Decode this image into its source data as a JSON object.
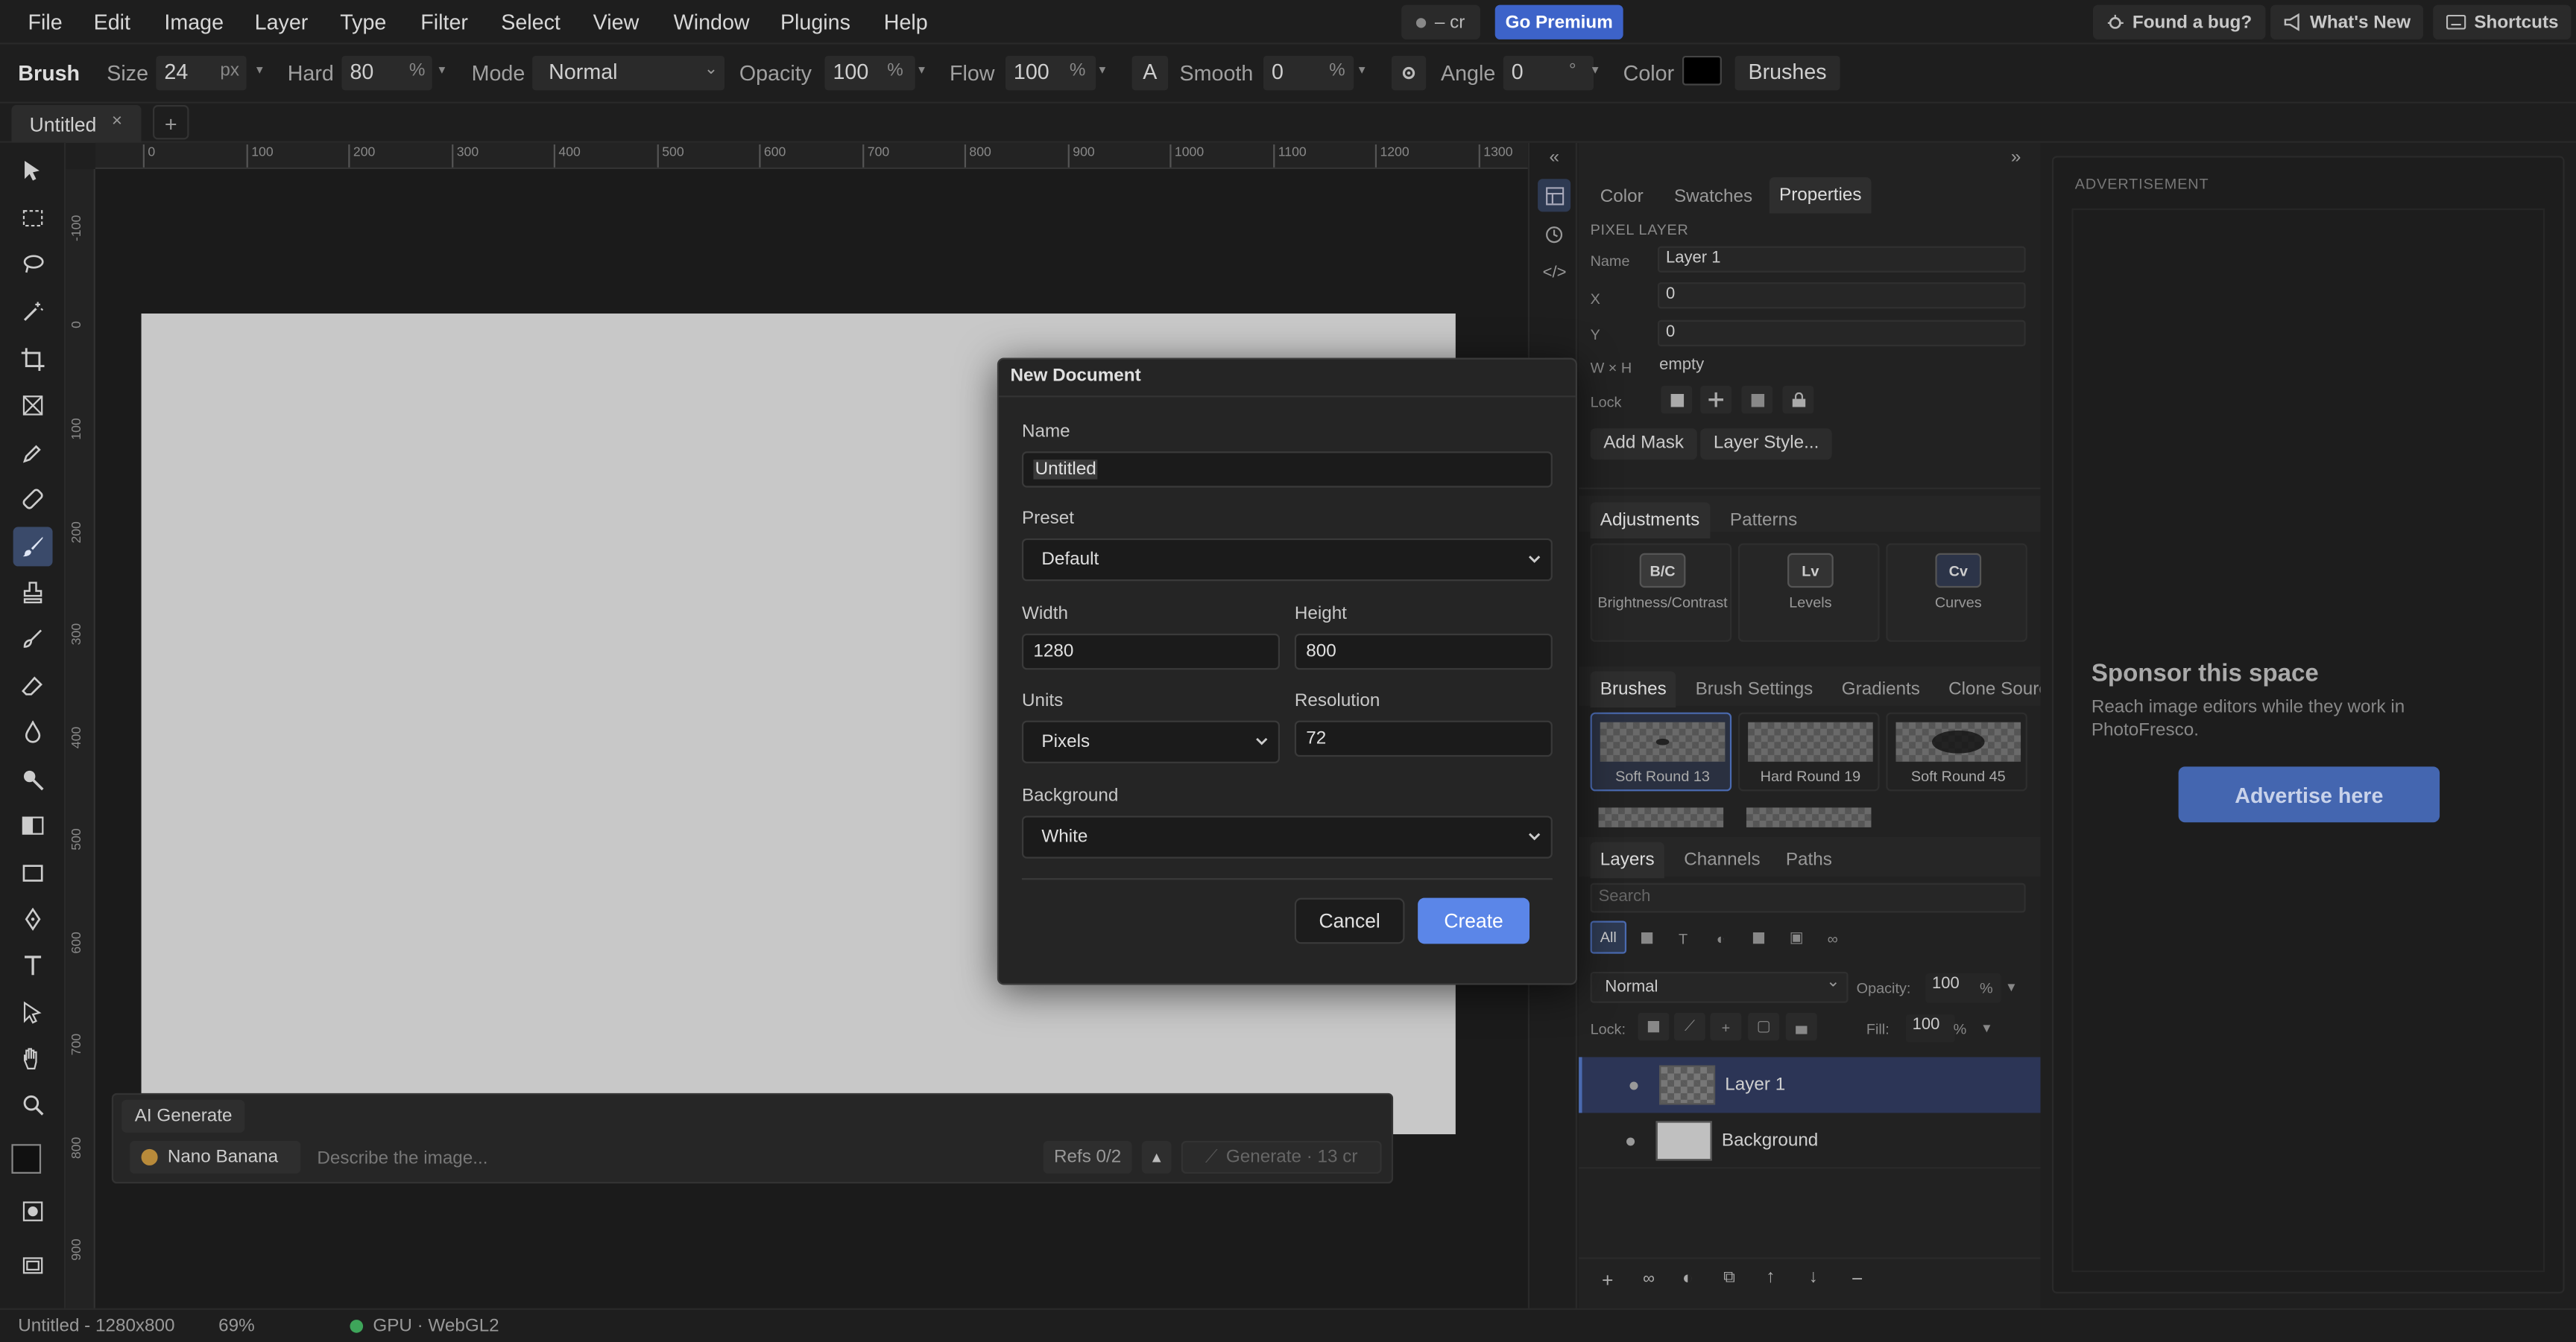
{
  "menubar": {
    "items": [
      "File",
      "Edit",
      "Image",
      "Layer",
      "Type",
      "Filter",
      "Select",
      "View",
      "Window",
      "Plugins",
      "Help"
    ],
    "credits": "– cr",
    "premium": "Go Premium",
    "bug": "Found a bug?",
    "whats_new": "What's New",
    "shortcuts": "Shortcuts"
  },
  "options": {
    "tool": "Brush",
    "size_label": "Size",
    "size": "24",
    "size_unit": "px",
    "hard_label": "Hard",
    "hard": "80",
    "hard_unit": "%",
    "mode_label": "Mode",
    "mode": "Normal",
    "opacity_label": "Opacity",
    "opacity": "100",
    "opacity_unit": "%",
    "flow_label": "Flow",
    "flow": "100",
    "flow_unit": "%",
    "a_label": "A",
    "smooth_label": "Smooth",
    "smooth": "0",
    "smooth_unit": "%",
    "angle_label": "Angle",
    "angle": "0",
    "angle_unit": "°",
    "color_label": "Color",
    "color": "#000000",
    "brushes": "Brushes"
  },
  "doc_tab": "Untitled",
  "ruler": {
    "x": [
      "0",
      "100",
      "200",
      "300",
      "400",
      "500",
      "600",
      "700",
      "800",
      "900",
      "1000",
      "1100",
      "1200",
      "1300"
    ],
    "y": [
      "-100",
      "0",
      "100",
      "200",
      "300",
      "400",
      "500",
      "600",
      "700",
      "800",
      "900"
    ]
  },
  "ai": {
    "tab": "AI Generate",
    "model": "Nano Banana",
    "placeholder": "Describe the image...",
    "refs": "Refs 0/2",
    "generate": "Generate · 13 cr"
  },
  "panel": {
    "tabs": [
      "Color",
      "Swatches",
      "Properties"
    ],
    "section": "PIXEL LAYER",
    "name_label": "Name",
    "name": "Layer 1",
    "x_label": "X",
    "x": "0",
    "y_label": "Y",
    "y": "0",
    "wh_label": "W × H",
    "wh": "empty",
    "lock_label": "Lock",
    "add_mask": "Add Mask",
    "layer_style": "Layer Style...",
    "adj_tabs": [
      "Adjustments",
      "Patterns"
    ],
    "adjustments": [
      {
        "icon": "B/C",
        "name": "Brightness/Contrast"
      },
      {
        "icon": "Lv",
        "name": "Levels"
      },
      {
        "icon": "Cv",
        "name": "Curves"
      }
    ],
    "brush_tabs": [
      "Brushes",
      "Brush Settings",
      "Gradients",
      "Clone Source"
    ],
    "brushes": [
      "Soft Round 13",
      "Hard Round 19",
      "Soft Round 45"
    ],
    "layer_tabs": [
      "Layers",
      "Channels",
      "Paths"
    ],
    "search_placeholder": "Search",
    "filter_all": "All",
    "blend": "Normal",
    "opacity_label": "Opacity:",
    "opacity": "100",
    "opacity_unit": "%",
    "lock_label2": "Lock:",
    "fill_label": "Fill:",
    "fill": "100",
    "fill_unit": "%",
    "layers": [
      {
        "name": "Layer 1",
        "selected": true
      },
      {
        "name": "Background",
        "selected": false
      }
    ]
  },
  "ad": {
    "label": "ADVERTISEMENT",
    "title": "Sponsor this space",
    "subtitle": "Reach image editors while they work in PhotoFresco.",
    "button": "Advertise here"
  },
  "status": {
    "doc": "Untitled - 1280x800",
    "zoom": "69%",
    "gpu": "GPU · WebGL2"
  },
  "dialog": {
    "title": "New Document",
    "name_label": "Name",
    "name": "Untitled",
    "preset_label": "Preset",
    "preset": "Default",
    "width_label": "Width",
    "width": "1280",
    "height_label": "Height",
    "height": "800",
    "units_label": "Units",
    "units": "Pixels",
    "resolution_label": "Resolution",
    "resolution": "72",
    "background_label": "Background",
    "background": "White",
    "cancel": "Cancel",
    "create": "Create"
  }
}
